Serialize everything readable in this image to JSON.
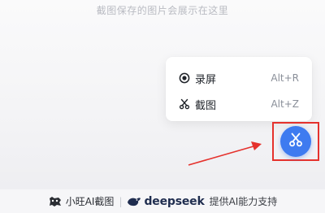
{
  "hint": "截图保存的图片会展示在这里",
  "menu": {
    "items": [
      {
        "icon": "record-icon",
        "label": "录屏",
        "shortcut": "Alt+R"
      },
      {
        "icon": "scissors-icon",
        "label": "截图",
        "shortcut": "Alt+Z"
      }
    ]
  },
  "fab": {
    "icon": "scissors-icon"
  },
  "footer": {
    "brand": "小旺AI截图",
    "separator": "|",
    "partner": "deepseek",
    "powered": "提供AI能力支持"
  },
  "colors": {
    "accent": "#3e7bf0",
    "highlight": "#e5322d"
  }
}
